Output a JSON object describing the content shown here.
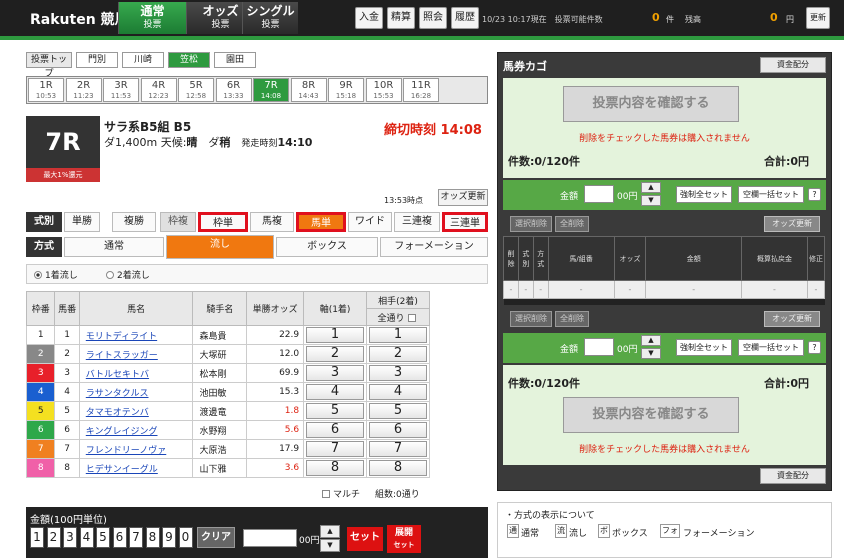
{
  "header": {
    "logo": "Rakuten 競馬",
    "tabs": [
      {
        "label": "通常",
        "sub": "投票"
      },
      {
        "label": "オッズ",
        "sub": "投票"
      },
      {
        "label": "シングル",
        "sub": "投票"
      }
    ],
    "buttons": [
      "入金",
      "精算",
      "照会",
      "履歴"
    ],
    "datetime": "10/23 10:17現在",
    "vote_possible_label": "投票可能件数",
    "vote_count": "0",
    "vote_count_unit": "件",
    "balance_label": "残高",
    "balance": "0",
    "balance_unit": "円",
    "refresh": "更新"
  },
  "venue_tabs": [
    "投票トップ",
    "門別",
    "川崎",
    "笠松",
    "園田"
  ],
  "race_tabs": [
    {
      "r": "1R",
      "t": "10:53"
    },
    {
      "r": "2R",
      "t": "11:23"
    },
    {
      "r": "3R",
      "t": "11:53"
    },
    {
      "r": "4R",
      "t": "12:23"
    },
    {
      "r": "5R",
      "t": "12:58"
    },
    {
      "r": "6R",
      "t": "13:33"
    },
    {
      "r": "7R",
      "t": "14:08"
    },
    {
      "r": "8R",
      "t": "14:43"
    },
    {
      "r": "9R",
      "t": "15:18"
    },
    {
      "r": "10R",
      "t": "15:53"
    },
    {
      "r": "11R",
      "t": "16:28"
    }
  ],
  "race": {
    "number": "7R",
    "badge": "最大1%還元",
    "name": "サラ系B5組 B5",
    "details_a": "ダ1,400m 天候:",
    "weather": "晴",
    "details_b": "ダ",
    "track": "稍",
    "details_c": "発走時刻",
    "start": "14:10",
    "deadline": "締切時刻 14:08",
    "odds_time": "13:53時点",
    "odds_update": "オッズ更新"
  },
  "shiki": {
    "label": "式別",
    "items": [
      "単勝",
      "複勝",
      "枠複",
      "枠単",
      "馬複",
      "馬単",
      "ワイド",
      "三連複",
      "三連単"
    ]
  },
  "houshiki": {
    "label": "方式",
    "items": [
      "通常",
      "流し",
      "ボックス",
      "フォーメーション"
    ]
  },
  "nagashi": [
    "1着流し",
    "2着流し"
  ],
  "table": {
    "headers": [
      "枠番",
      "馬番",
      "馬名",
      "騎手名",
      "単勝オッズ",
      "軸(1着)",
      "相手(2着)"
    ],
    "all_label": "全通り",
    "rows": [
      {
        "waku": "1",
        "uma": "1",
        "name": "モリトディライト",
        "jockey": "森島貴",
        "odds": "22.9"
      },
      {
        "waku": "2",
        "uma": "2",
        "name": "ライトスラッガー",
        "jockey": "大塚研",
        "odds": "12.0"
      },
      {
        "waku": "3",
        "uma": "3",
        "name": "バトルセキトバ",
        "jockey": "松本剛",
        "odds": "69.9"
      },
      {
        "waku": "4",
        "uma": "4",
        "name": "ラサンタクルス",
        "jockey": "池田敏",
        "odds": "15.3"
      },
      {
        "waku": "5",
        "uma": "5",
        "name": "タマモオテンバ",
        "jockey": "渡邊竜",
        "odds": "1.8"
      },
      {
        "waku": "6",
        "uma": "6",
        "name": "キングレイジング",
        "jockey": "水野翔",
        "odds": "5.6"
      },
      {
        "waku": "7",
        "uma": "7",
        "name": "フレンドリーノヴァ",
        "jockey": "大原浩",
        "odds": "17.9"
      },
      {
        "waku": "8",
        "uma": "8",
        "name": "ヒデサンイーグル",
        "jockey": "山下雅",
        "odds": "3.6"
      }
    ],
    "waku_colors": [
      "#ffffff",
      "#888888",
      "#e8202a",
      "#1a5fd0",
      "#f4e020",
      "#2ea84a",
      "#f08020",
      "#f060a8"
    ],
    "waku_text": [
      "#222",
      "#fff",
      "#fff",
      "#fff",
      "#222",
      "#fff",
      "#fff",
      "#fff"
    ],
    "multi": "マルチ",
    "kumi": "組数:0通り"
  },
  "amount": {
    "label": "金額(100円単位)",
    "digits": [
      "1",
      "2",
      "3",
      "4",
      "5",
      "6",
      "7",
      "8",
      "9",
      "0"
    ],
    "clear": "クリア",
    "yen": "00円",
    "set": "セット",
    "tenkai_a": "展開",
    "tenkai_b": "セット"
  },
  "cart": {
    "title": "馬券カゴ",
    "shikin": "資金配分",
    "confirm": "投票内容を確認する",
    "notice": "削除をチェックした馬券は購入されません",
    "count": "件数:0/120件",
    "total": "合計:0円",
    "kingaku": "金額",
    "yen": "00円",
    "force_set": "強制全セット",
    "blank_set": "空欄一括セット",
    "q": "?",
    "sel_del": "選択削除",
    "all_del": "全削除",
    "odds_update": "オッズ更新",
    "cols": [
      "削除",
      "式別",
      "方式",
      "馬/組番",
      "オッズ",
      "金額",
      "概算払戻金",
      "修正"
    ],
    "empty": "-"
  },
  "legend": {
    "title": "・方式の表示について",
    "items": [
      {
        "k": "通",
        "v": "通常"
      },
      {
        "k": "流",
        "v": "流し"
      },
      {
        "k": "ボ",
        "v": "ボックス"
      },
      {
        "k": "フォ",
        "v": "フォーメーション"
      }
    ]
  }
}
